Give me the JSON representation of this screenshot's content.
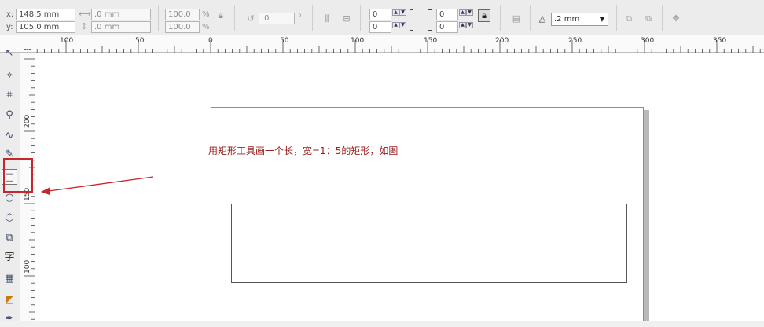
{
  "property_bar": {
    "x_label": "x:",
    "y_label": "y:",
    "x_value": "148.5 mm",
    "y_value": "105.0 mm",
    "width_value": ".0 mm",
    "height_value": ".0 mm",
    "scale_x": "100.0",
    "scale_y": "100.0",
    "percent_symbol": "%",
    "rotation_value": ".0",
    "degree_symbol": "°",
    "corner_top_left": "0",
    "corner_bottom_left": "0",
    "corner_top_right": "0",
    "corner_bottom_right": "0",
    "outline_width": ".2 mm"
  },
  "ruler": {
    "top_labels": [
      "100",
      "50",
      "0",
      "50",
      "100",
      "150",
      "200",
      "250",
      "300",
      "350"
    ],
    "left_labels": [
      "200",
      "150",
      "100"
    ]
  },
  "toolbox": {
    "text_tool_glyph": "字"
  },
  "annotation": {
    "text": "用矩形工具画一个长，宽=1：5的矩形，如图"
  },
  "colors": {
    "annotation": "#9b1c1c",
    "highlight": "#c8252c"
  }
}
